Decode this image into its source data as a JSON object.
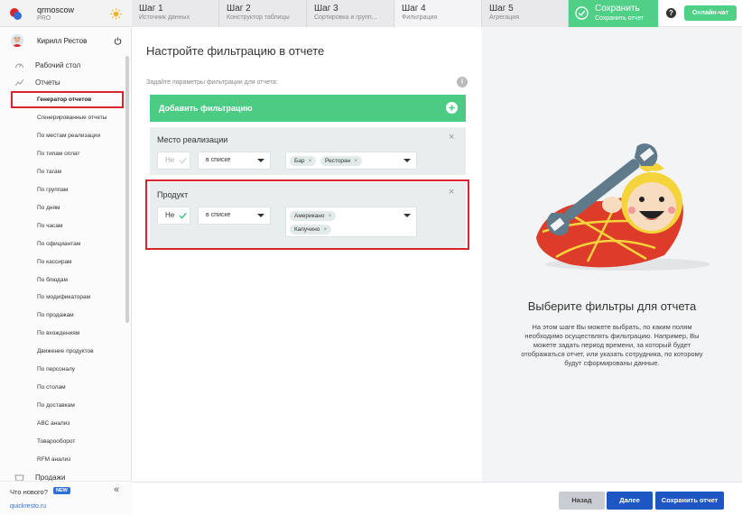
{
  "brand": {
    "name": "qrmoscow",
    "plan": "PRO"
  },
  "user": {
    "name": "Кирилл Рестов"
  },
  "nav": {
    "desktop": "Рабочий стол",
    "reports": "Отчеты",
    "sales": "Продажи",
    "sub_items": [
      "Генератор отчетов",
      "Сгенерированные отчеты",
      "По местам реализации",
      "По типам оплат",
      "По тагам",
      "По группам",
      "По дням",
      "По часам",
      "По официантам",
      "По кассирам",
      "По блюдам",
      "По модификаторам",
      "По продажам",
      "По вхождениям",
      "Движение продуктов",
      "По персоналу",
      "По столам",
      "По доставкам",
      "ABC анализ",
      "Товарооборот",
      "RFM анализ"
    ]
  },
  "sidebar_footer": {
    "whats_new": "Что нового?",
    "badge": "NEW",
    "site": "quickresto.ru"
  },
  "steps": [
    {
      "title": "Шаг 1",
      "subtitle": "Источник данных"
    },
    {
      "title": "Шаг 2",
      "subtitle": "Конструктор таблицы"
    },
    {
      "title": "Шаг 3",
      "subtitle": "Сортировка и групп..."
    },
    {
      "title": "Шаг 4",
      "subtitle": "Фильтрация"
    },
    {
      "title": "Шаг 5",
      "subtitle": "Агрегация"
    }
  ],
  "save_step": {
    "title": "Сохранить",
    "subtitle": "Сохранить отчет"
  },
  "help": "?",
  "chat": "Онлайн-чат",
  "main": {
    "title": "Настройте фильтрацию в отчете",
    "hint": "Задайте параметры фильтрации для отчета:",
    "add_filter": "Добавить фильтрацию"
  },
  "filters": [
    {
      "title": "Место реализации",
      "negation": "Не",
      "condition": "в списке",
      "values": [
        "Бар",
        "Ресторан"
      ]
    },
    {
      "title": "Продукт",
      "negation": "Не",
      "condition": "в списке",
      "values": [
        "Американо",
        "Капучино"
      ]
    }
  ],
  "right": {
    "title": "Выберите фильтры для отчета",
    "description": "На этом шаге Вы можете выбрать, по каким полям необходимо осуществлять фильтрацию. Например, Вы можете задать период времени, за который будет отображаться отчет, или указать сотрудника, по которому будут сформированы данные."
  },
  "footer": {
    "back": "Назад",
    "next": "Далее",
    "save": "Сохранить отчет"
  },
  "colors": {
    "accent_green": "#4bcb84",
    "primary_blue": "#1e57c4",
    "highlight_red": "#d9252c"
  }
}
